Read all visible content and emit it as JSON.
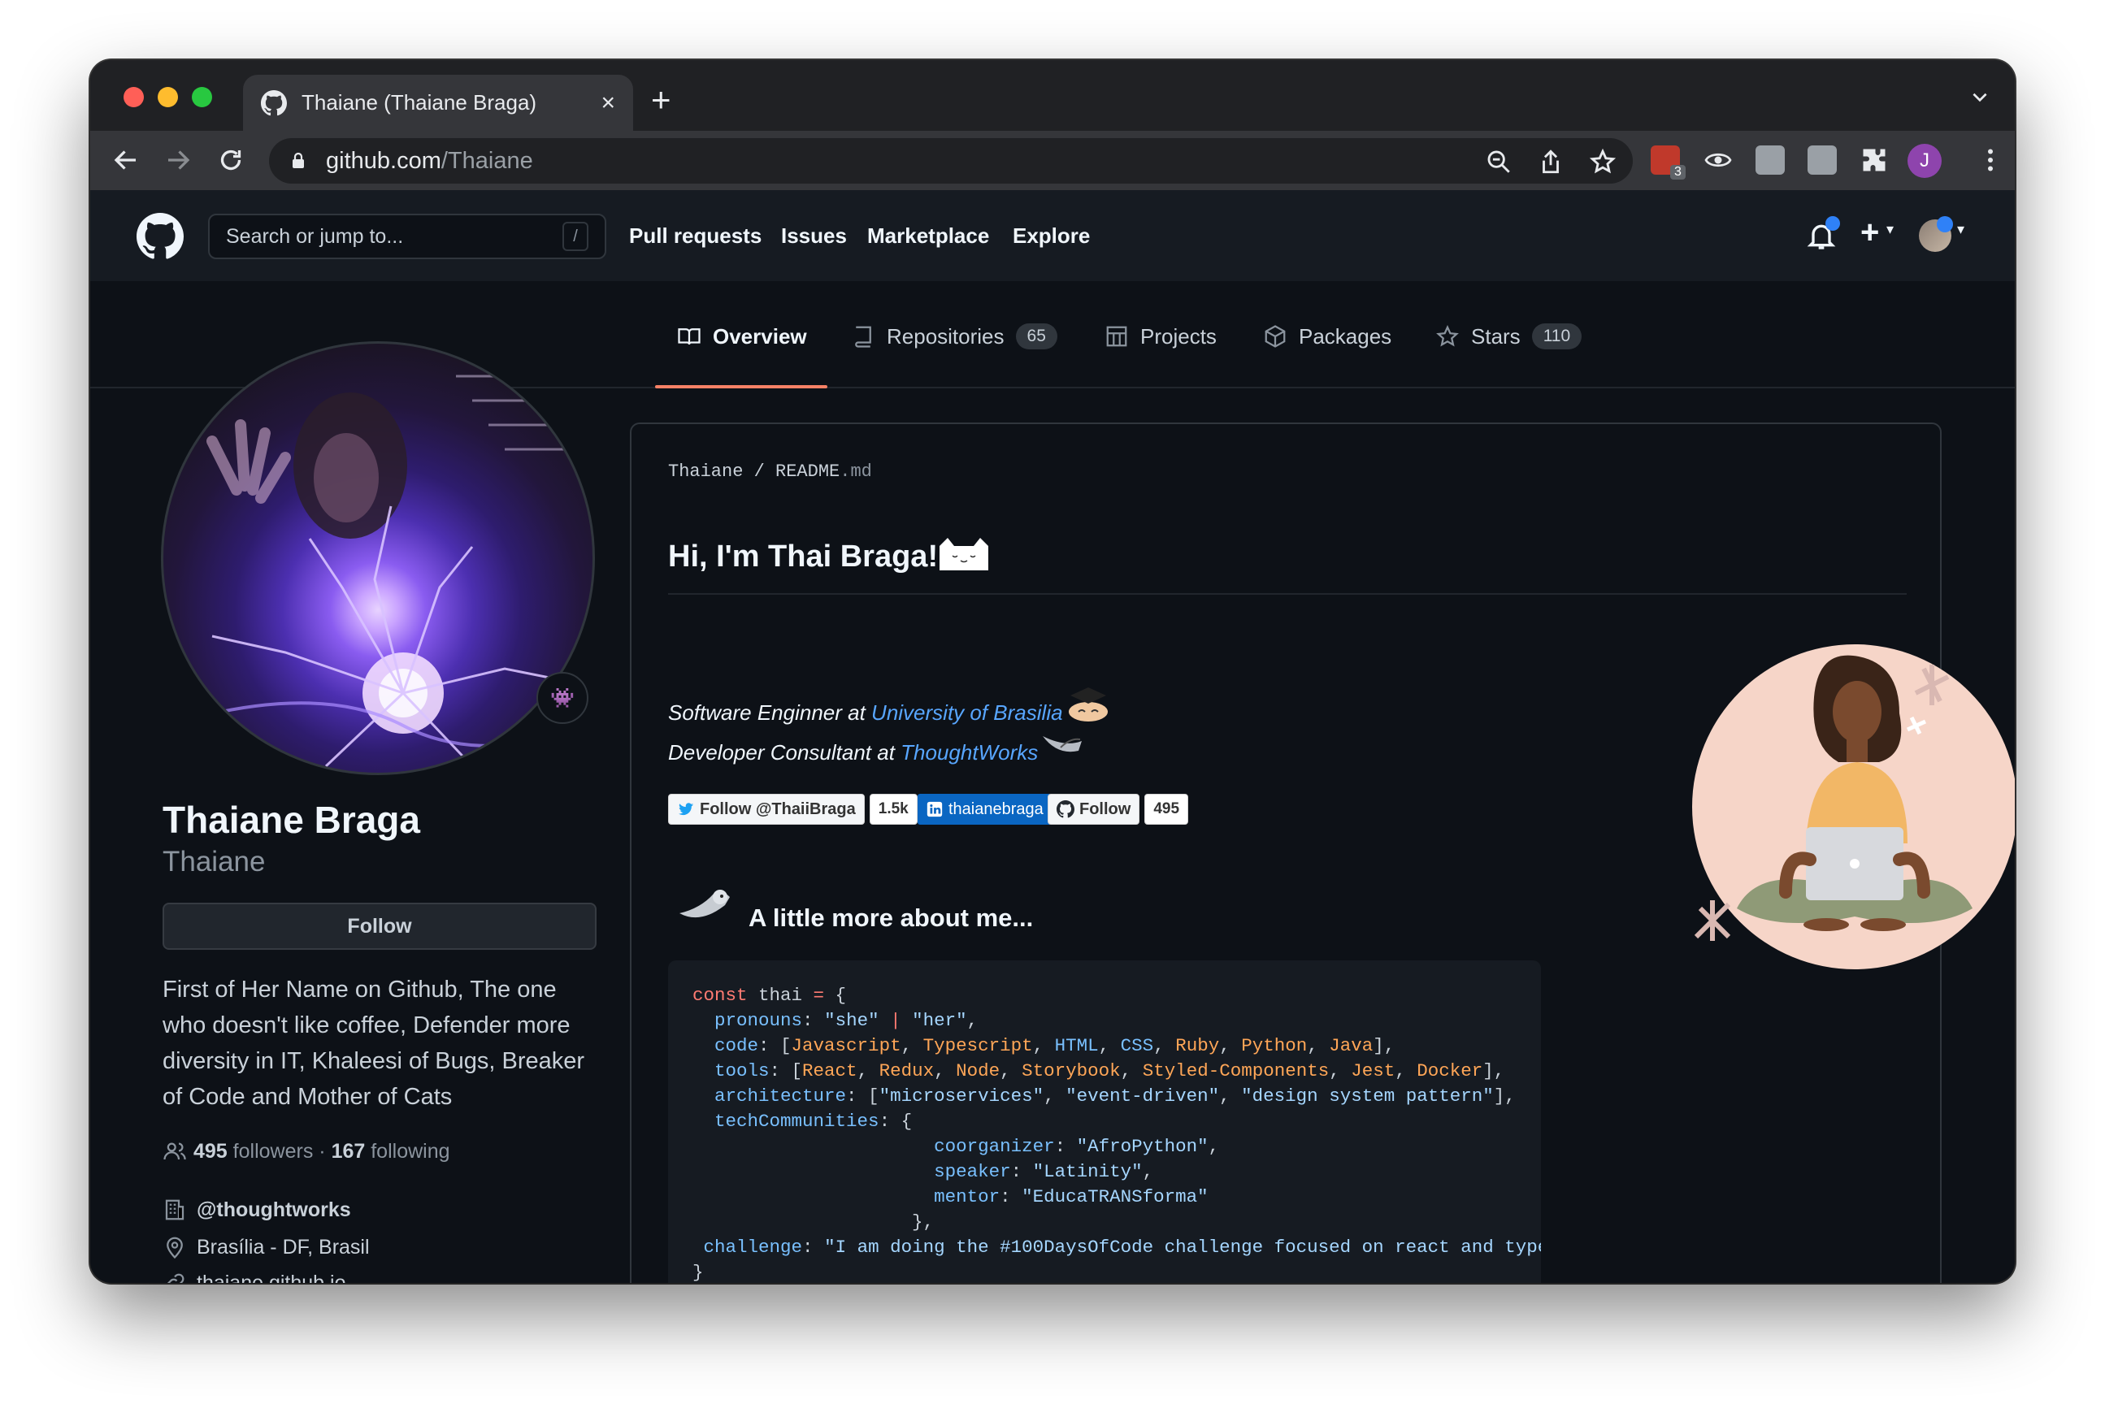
{
  "browser": {
    "tab_title": "Thaiane (Thaiane Braga)",
    "tab_close": "×",
    "new_tab": "+",
    "url_host": "github.com",
    "url_path": "/Thaiane",
    "extension_badge": "3",
    "profile_initial": "J",
    "colors": {
      "profile": "#8e44ad",
      "ublock": "#c0392b"
    }
  },
  "header": {
    "search_placeholder": "Search or jump to...",
    "search_shortcut": "/",
    "nav": [
      "Pull requests",
      "Issues",
      "Marketplace",
      "Explore"
    ]
  },
  "tabs": {
    "overview": "Overview",
    "repositories": "Repositories",
    "repositories_count": "65",
    "projects": "Projects",
    "packages": "Packages",
    "stars": "Stars",
    "stars_count": "110"
  },
  "profile": {
    "name": "Thaiane Braga",
    "login": "Thaiane",
    "follow_label": "Follow",
    "bio": "First of Her Name on Github, The one who doesn't like coffee, Defender more diversity in IT, Khaleesi of Bugs, Breaker of Code and Mother of Cats",
    "followers_count": "495",
    "followers_label": "followers",
    "separator": "·",
    "following_count": "167",
    "following_label": "following",
    "organization": "@thoughtworks",
    "location": "Brasília - DF, Brasil",
    "website": "thaiane.github.io"
  },
  "readme": {
    "owner": "Thaiane",
    "slash": "/",
    "file_base": "README",
    "file_ext": ".md",
    "title": "Hi, I'm Thai Braga!",
    "line1_prefix": "Software Enginner at ",
    "line1_link": "University of Brasilia",
    "line2_prefix": "Developer Consultant at ",
    "line2_link": "ThoughtWorks",
    "badges": {
      "twitter_label": "Follow @ThaiiBraga",
      "twitter_count": "1.5k",
      "linkedin_label": "thaianebraga",
      "github_label": "Follow",
      "github_count": "495"
    },
    "more_heading": "A little more about me..."
  }
}
